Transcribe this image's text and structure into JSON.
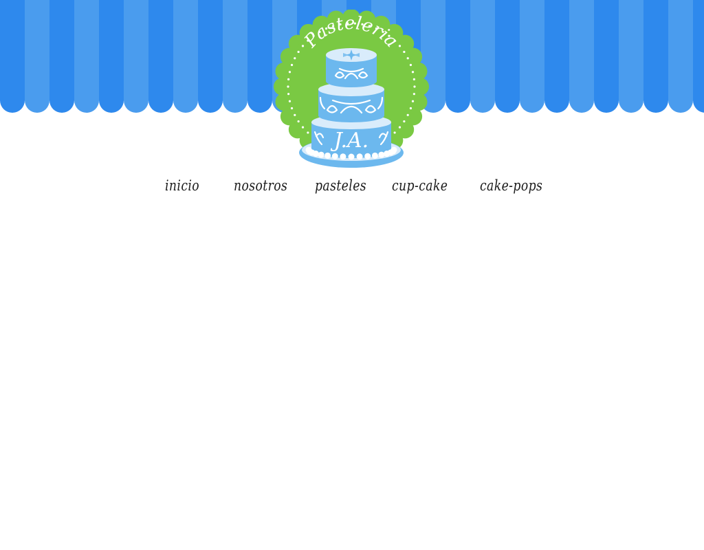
{
  "site": {
    "logo": {
      "brand_text": "Pasteleria",
      "monogram": "J.A.",
      "badge_color": "#7ac943",
      "cake_color": "#6cb8ee",
      "cake_light": "#d9ecfb"
    },
    "awning": {
      "stripe_dark": "#2e89ed",
      "stripe_light": "#4a9cee"
    }
  },
  "nav": {
    "items": [
      {
        "label": "inicio"
      },
      {
        "label": "nosotros"
      },
      {
        "label": "pasteles"
      },
      {
        "label": "cup-cake"
      },
      {
        "label": "cake-pops"
      }
    ]
  }
}
